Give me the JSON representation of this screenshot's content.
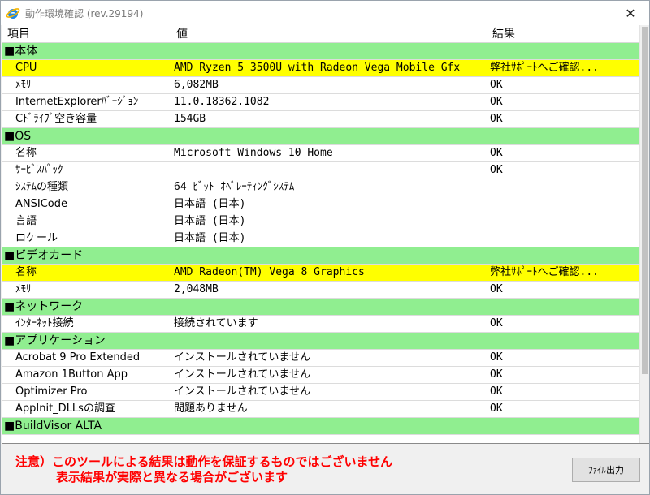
{
  "window": {
    "title": "動作環境確認 (rev.29194)",
    "close_glyph": "✕"
  },
  "colors": {
    "section_row": "#90ee90",
    "warning_row": "#ffff00",
    "notice_text": "#ff0000"
  },
  "grid": {
    "columns": [
      "項目",
      "値",
      "結果"
    ],
    "rows": [
      {
        "type": "section",
        "item": "■本体",
        "value": "",
        "result": ""
      },
      {
        "type": "warn",
        "item": "CPU",
        "value": "AMD Ryzen 5 3500U with Radeon Vega Mobile Gfx",
        "result": "弊社ｻﾎﾟｰﾄへご確認..."
      },
      {
        "type": "normal",
        "item": "ﾒﾓﾘ",
        "value": "6,082MB",
        "result": "OK"
      },
      {
        "type": "normal",
        "item": "InternetExplorerﾊﾞｰｼﾞｮﾝ",
        "value": "11.0.18362.1082",
        "result": "OK"
      },
      {
        "type": "normal",
        "item": "Cﾄﾞﾗｲﾌﾞ空き容量",
        "value": "154GB",
        "result": "OK"
      },
      {
        "type": "section",
        "item": "■OS",
        "value": "",
        "result": ""
      },
      {
        "type": "normal",
        "item": "名称",
        "value": "Microsoft Windows 10 Home",
        "result": "OK"
      },
      {
        "type": "normal",
        "item": "ｻｰﾋﾞｽﾊﾟｯｸ",
        "value": "",
        "result": "OK"
      },
      {
        "type": "normal",
        "item": "ｼｽﾃﾑの種類",
        "value": "64 ﾋﾞｯﾄ ｵﾍﾟﾚｰﾃｨﾝｸﾞｼｽﾃﾑ",
        "result": ""
      },
      {
        "type": "normal",
        "item": "ANSICode",
        "value": "日本語 (日本)",
        "result": ""
      },
      {
        "type": "normal",
        "item": "言語",
        "value": "日本語 (日本)",
        "result": ""
      },
      {
        "type": "normal",
        "item": "ロケール",
        "value": "日本語 (日本)",
        "result": ""
      },
      {
        "type": "section",
        "item": "■ビデオカード",
        "value": "",
        "result": ""
      },
      {
        "type": "warn",
        "item": "名称",
        "value": "AMD Radeon(TM) Vega 8 Graphics",
        "result": "弊社ｻﾎﾟｰﾄへご確認..."
      },
      {
        "type": "normal",
        "item": "ﾒﾓﾘ",
        "value": "2,048MB",
        "result": "OK"
      },
      {
        "type": "section",
        "item": "■ネットワーク",
        "value": "",
        "result": ""
      },
      {
        "type": "normal",
        "item": "ｲﾝﾀｰﾈｯﾄ接続",
        "value": "接続されています",
        "result": "OK"
      },
      {
        "type": "section",
        "item": "■アプリケーション",
        "value": "",
        "result": ""
      },
      {
        "type": "normal",
        "item": "Acrobat 9 Pro Extended",
        "value": "インストールされていません",
        "result": "OK"
      },
      {
        "type": "normal",
        "item": "Amazon 1Button App",
        "value": "インストールされていません",
        "result": "OK"
      },
      {
        "type": "normal",
        "item": "Optimizer Pro",
        "value": "インストールされていません",
        "result": "OK"
      },
      {
        "type": "normal",
        "item": "AppInit_DLLsの調査",
        "value": "問題ありません",
        "result": "OK"
      },
      {
        "type": "section",
        "item": "■BuildVisor ALTA",
        "value": "",
        "result": ""
      },
      {
        "type": "normal",
        "item": "",
        "value": "",
        "result": ""
      }
    ]
  },
  "notice": {
    "line1": "注意）このツールによる結果は動作を保証するものではございません",
    "line2": "表示結果が実際と異なる場合がございます"
  },
  "export_button": {
    "label": "ﾌｧｲﾙ出力"
  }
}
